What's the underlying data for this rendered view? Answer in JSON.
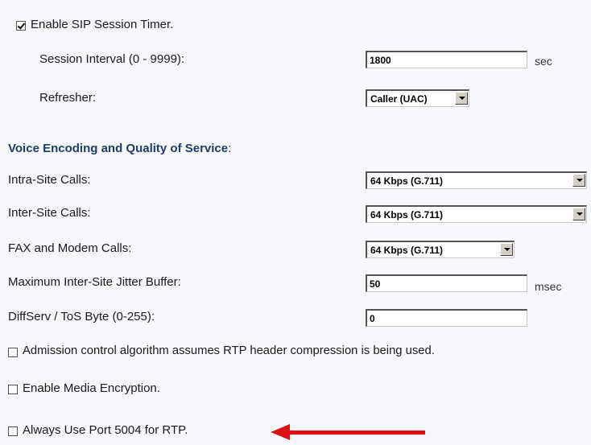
{
  "session_timer": {
    "enable_label": "Enable SIP Session Timer.",
    "enabled": true,
    "interval_label": "Session Interval (0 - 9999):",
    "interval_value": "1800",
    "interval_unit": "sec",
    "refresher_label": "Refresher:",
    "refresher_value": "Caller (UAC)"
  },
  "voice": {
    "title": "Voice Encoding and Quality of Service",
    "title_suffix": ":",
    "intra_label": "Intra-Site Calls:",
    "intra_value": "64 Kbps (G.711)",
    "inter_label": "Inter-Site Calls:",
    "inter_value": "64 Kbps (G.711)",
    "fax_label": "FAX and Modem Calls:",
    "fax_value": "64 Kbps (G.711)",
    "jitter_label": "Maximum Inter-Site Jitter Buffer:",
    "jitter_value": "50",
    "jitter_unit": "msec",
    "diffserv_label": "DiffServ / ToS Byte (0-255):",
    "diffserv_value": "0"
  },
  "options": {
    "admission_label": "Admission control algorithm assumes RTP header compression is being used.",
    "admission_checked": false,
    "encryption_label": "Enable Media Encryption.",
    "encryption_checked": false,
    "port_label": "Always Use Port 5004 for RTP.",
    "port_checked": false
  },
  "colors": {
    "section_title": "#1f3c64",
    "arrow": "#e01010",
    "background": "#f7f8fb"
  }
}
